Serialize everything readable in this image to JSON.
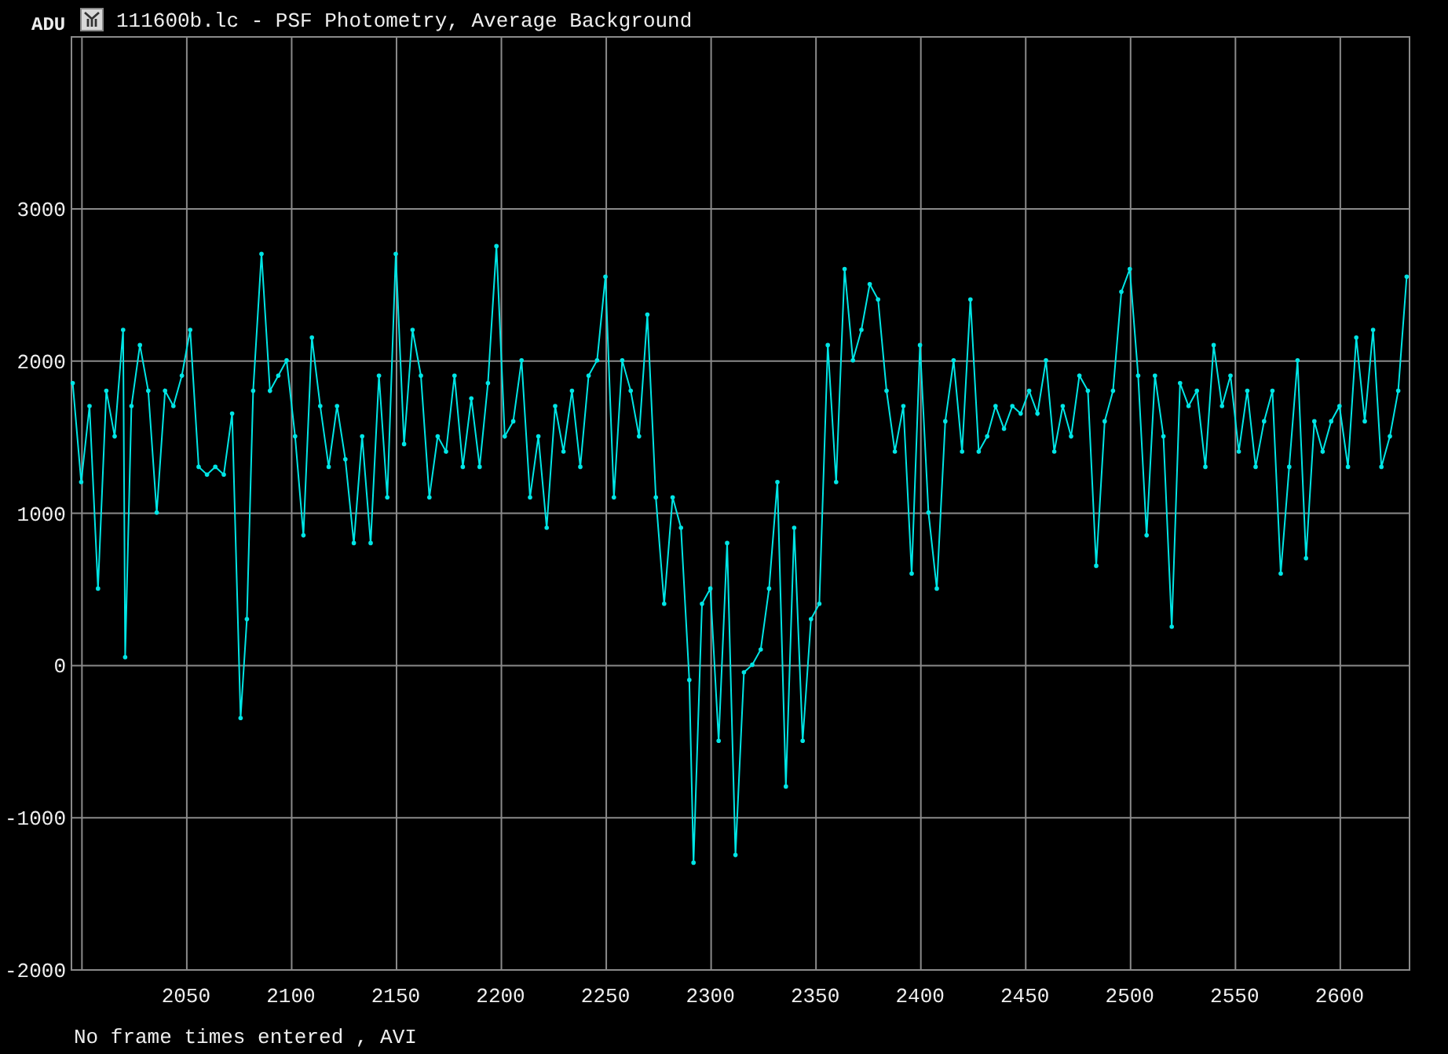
{
  "window": {
    "title": "111600b.lc - PSF Photometry, Average Background"
  },
  "chart_data": {
    "type": "line",
    "grid": true,
    "ylabel": "ADU",
    "xlim": [
      1995,
      2633
    ],
    "ylim": [
      -2000,
      4130
    ],
    "xticks": [
      2050,
      2100,
      2150,
      2200,
      2250,
      2300,
      2350,
      2400,
      2450,
      2500,
      2550,
      2600
    ],
    "yticks": [
      -2000,
      -1000,
      0,
      1000,
      2000,
      3000
    ],
    "x": [
      1996,
      2000,
      2004,
      2008,
      2012,
      2016,
      2020,
      2021,
      2024,
      2028,
      2032,
      2036,
      2040,
      2044,
      2048,
      2052,
      2056,
      2060,
      2064,
      2068,
      2072,
      2076,
      2079,
      2082,
      2086,
      2090,
      2094,
      2098,
      2102,
      2106,
      2110,
      2114,
      2118,
      2122,
      2126,
      2130,
      2134,
      2138,
      2142,
      2146,
      2150,
      2154,
      2158,
      2162,
      2166,
      2170,
      2174,
      2178,
      2182,
      2186,
      2190,
      2194,
      2198,
      2202,
      2206,
      2210,
      2214,
      2218,
      2222,
      2226,
      2230,
      2234,
      2238,
      2242,
      2246,
      2250,
      2254,
      2258,
      2262,
      2266,
      2270,
      2274,
      2278,
      2282,
      2286,
      2290,
      2292,
      2296,
      2300,
      2304,
      2308,
      2312,
      2316,
      2320,
      2324,
      2328,
      2332,
      2336,
      2340,
      2344,
      2348,
      2352,
      2356,
      2360,
      2364,
      2368,
      2372,
      2376,
      2380,
      2384,
      2388,
      2392,
      2396,
      2400,
      2404,
      2408,
      2412,
      2416,
      2420,
      2424,
      2428,
      2432,
      2436,
      2440,
      2444,
      2448,
      2452,
      2456,
      2460,
      2464,
      2468,
      2472,
      2476,
      2480,
      2484,
      2488,
      2492,
      2496,
      2500,
      2504,
      2508,
      2512,
      2516,
      2520,
      2524,
      2528,
      2532,
      2536,
      2540,
      2544,
      2548,
      2552,
      2556,
      2560,
      2564,
      2568,
      2572,
      2576,
      2580,
      2584,
      2588,
      2592,
      2596,
      2600,
      2604,
      2608,
      2612,
      2616,
      2620,
      2624,
      2628,
      2632
    ],
    "series": [
      {
        "color": "#00e5e5",
        "values": [
          1850,
          1200,
          1700,
          500,
          1800,
          1500,
          2200,
          50,
          1700,
          2100,
          1800,
          1000,
          1800,
          1700,
          1900,
          2200,
          1300,
          1250,
          1300,
          1250,
          1650,
          -350,
          300,
          1800,
          2700,
          1800,
          1900,
          2000,
          1500,
          850,
          2150,
          1700,
          1300,
          1700,
          1350,
          800,
          1500,
          800,
          1900,
          1100,
          2700,
          1450,
          2200,
          1900,
          1100,
          1500,
          1400,
          1900,
          1300,
          1750,
          1300,
          1850,
          2750,
          1500,
          1600,
          2000,
          1100,
          1500,
          900,
          1700,
          1400,
          1800,
          1300,
          1900,
          2000,
          2550,
          1100,
          2000,
          1800,
          1500,
          2300,
          1100,
          400,
          1100,
          900,
          -100,
          -1300,
          400,
          500,
          -500,
          800,
          -1250,
          -50,
          0,
          100,
          500,
          1200,
          -800,
          900,
          -500,
          300,
          400,
          2100,
          1200,
          2600,
          2000,
          2200,
          2500,
          2400,
          1800,
          1400,
          1700,
          600,
          2100,
          1000,
          500,
          1600,
          2000,
          1400,
          2400,
          1400,
          1500,
          1700,
          1550,
          1700,
          1650,
          1800,
          1650,
          2000,
          1400,
          1700,
          1500,
          1900,
          1800,
          650,
          1600,
          1800,
          2450,
          2600,
          1900,
          850,
          1900,
          1500,
          250,
          1850,
          1700,
          1800,
          1300,
          2100,
          1700,
          1900,
          1400,
          1800,
          1300,
          1600,
          1800,
          600,
          1300,
          2000,
          700,
          1600,
          1400,
          1600,
          1700,
          1300,
          2150,
          1600,
          2200,
          1300,
          1500,
          1800,
          2550
        ]
      }
    ]
  },
  "status_bar": {
    "text": "No frame times entered , AVI"
  }
}
